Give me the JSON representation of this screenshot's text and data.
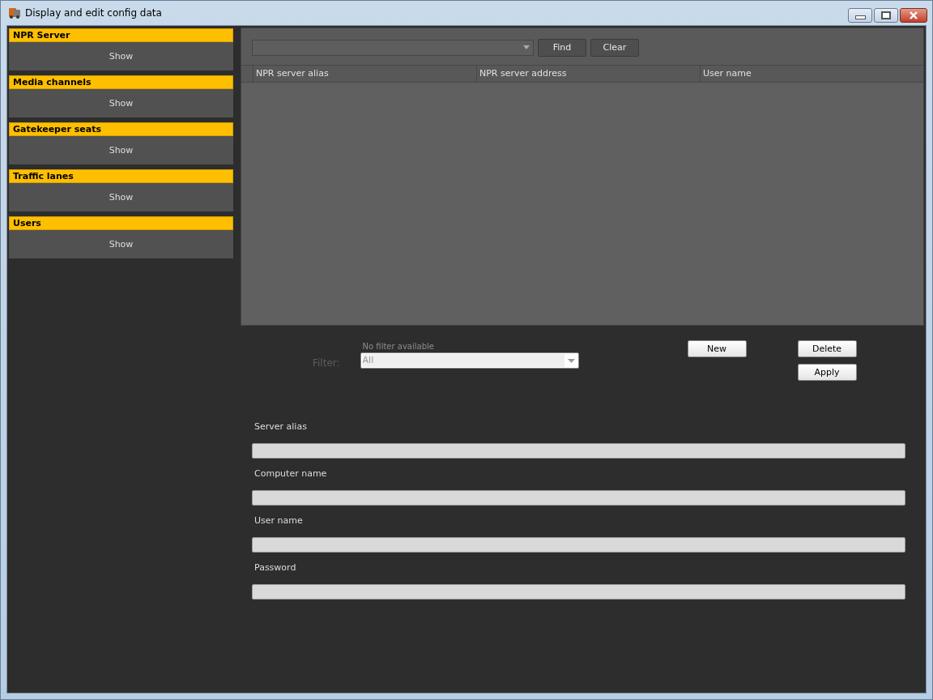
{
  "window": {
    "title": "Display and edit config data"
  },
  "sidebar": {
    "sections": [
      {
        "title": "NPR Server",
        "button": "Show"
      },
      {
        "title": "Media channels",
        "button": "Show"
      },
      {
        "title": "Gatekeeper seats",
        "button": "Show"
      },
      {
        "title": "Traffic lanes",
        "button": "Show"
      },
      {
        "title": "Users",
        "button": "Show"
      }
    ]
  },
  "search": {
    "find_button": "Find",
    "clear_button": "Clear"
  },
  "table": {
    "columns": [
      "NPR server alias",
      "NPR server address",
      "User name"
    ]
  },
  "filter": {
    "label": "Filter:",
    "hint": "No filter available",
    "value": "All",
    "disabled": true
  },
  "buttons": {
    "new": "New",
    "delete": "Delete",
    "apply": "Apply"
  },
  "form": {
    "fields": [
      {
        "label": "Server alias"
      },
      {
        "label": "Computer name"
      },
      {
        "label": "User name"
      },
      {
        "label": "Password"
      }
    ]
  }
}
